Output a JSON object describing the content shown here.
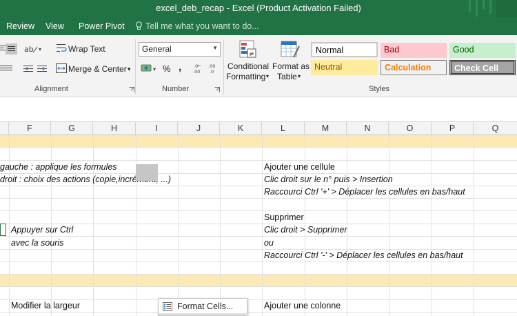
{
  "window": {
    "title": "excel_deb_recap - Excel (Product Activation Failed)"
  },
  "menu": {
    "tabs": [
      "Review",
      "View",
      "Power Pivot"
    ],
    "tell_me": "Tell me what you want to do..."
  },
  "ribbon": {
    "alignment": {
      "wrap_text": "Wrap Text",
      "merge_center": "Merge & Center",
      "label": "Alignment"
    },
    "number": {
      "format_value": "General",
      "percent_symbol": "%",
      "comma_symbol": ",",
      "label": "Number"
    },
    "styles": {
      "conditional_formatting_line1": "Conditional",
      "conditional_formatting_line2": "Formatting",
      "format_as_table_line1": "Format as",
      "format_as_table_line2": "Table",
      "cell_styles": [
        "Normal",
        "Bad",
        "Good",
        "Neutral",
        "Calculation",
        "Check Cell"
      ],
      "label": "Styles"
    }
  },
  "columns": [
    "F",
    "G",
    "H",
    "I",
    "J",
    "K",
    "L",
    "M",
    "N",
    "O",
    "P",
    "Q"
  ],
  "cells": {
    "left_r1": "gauche : applique les formules",
    "left_r2": "droit : choix des actions (copie,incrément, ...)",
    "right_r1": "Ajouter une cellule",
    "right_r2": "Clic droit sur le n° puis > Insertion",
    "right_r3": "Raccourci Ctrl '+' > Déplacer les cellules en bas/haut",
    "right_r5": "Supprimer",
    "right_r6": "Clic droit > Supprimer",
    "right_r7": "ou",
    "right_r8": "Raccourci Ctrl '-' > Déplacer les cellules en bas/haut",
    "f_r6": "Appuyer sur Ctrl",
    "f_r7": "avec la souris",
    "f_r11": "Modifier la largeur",
    "right_r11": "Ajouter une colonne"
  },
  "context_menu": {
    "format_cells": "Format Cells..."
  },
  "colors": {
    "excel_green": "#217346",
    "band_yellow": "#fde9b6"
  }
}
